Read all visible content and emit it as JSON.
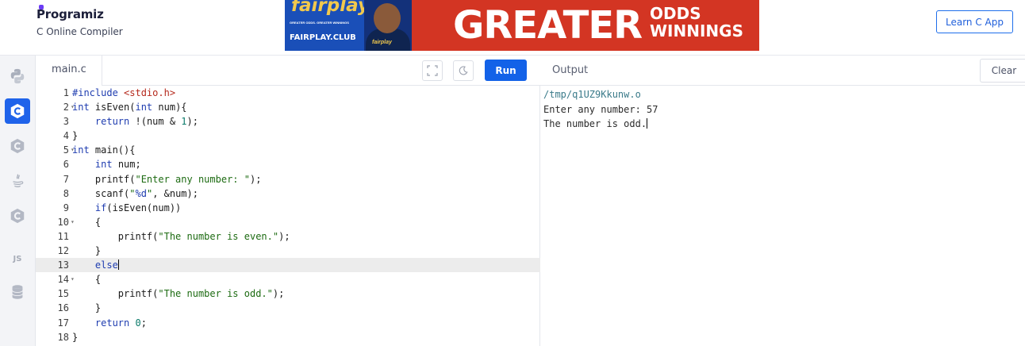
{
  "header": {
    "brand_name": "Programiz",
    "brand_subtitle": "C Online Compiler",
    "learn_button": "Learn C App",
    "ad": {
      "brand": "fairplay",
      "tagline": "GREATER ODDS. GREATER WINNINGS",
      "site": "FAIRPLAY.CLUB",
      "player_logo": "fairplay",
      "headline": "GREATER",
      "headline_right_1": "ODDS",
      "headline_right_2": "WINNINGS"
    }
  },
  "sidebar": {
    "items": [
      {
        "icon": "python-icon",
        "active": false
      },
      {
        "icon": "c-icon",
        "active": true
      },
      {
        "icon": "cpp-icon",
        "active": false
      },
      {
        "icon": "java-icon",
        "active": false
      },
      {
        "icon": "csharp-icon",
        "active": false
      },
      {
        "icon": "js-icon",
        "label": "JS",
        "active": false
      },
      {
        "icon": "database-icon",
        "active": false
      }
    ]
  },
  "editor": {
    "file_tab": "main.c",
    "run_label": "Run",
    "current_line": 13,
    "lines": [
      {
        "n": "1",
        "fold": false
      },
      {
        "n": "2",
        "fold": true
      },
      {
        "n": "3",
        "fold": false
      },
      {
        "n": "4",
        "fold": false
      },
      {
        "n": "5",
        "fold": true
      },
      {
        "n": "6",
        "fold": false
      },
      {
        "n": "7",
        "fold": false
      },
      {
        "n": "8",
        "fold": false
      },
      {
        "n": "9",
        "fold": false
      },
      {
        "n": "10",
        "fold": true
      },
      {
        "n": "11",
        "fold": false
      },
      {
        "n": "12",
        "fold": false
      },
      {
        "n": "13",
        "fold": false
      },
      {
        "n": "14",
        "fold": true
      },
      {
        "n": "15",
        "fold": false
      },
      {
        "n": "16",
        "fold": false
      },
      {
        "n": "17",
        "fold": false
      },
      {
        "n": "18",
        "fold": false
      }
    ],
    "code": {
      "l1_inc": "#include",
      "l1_hdr": "<stdio.h>",
      "l2_kw1": "int",
      "l2_a": " isEven(",
      "l2_kw2": "int",
      "l2_b": " num){",
      "l3_kw": "return",
      "l3_a": " !(num & ",
      "l3_num": "1",
      "l3_b": ");",
      "l4": "}",
      "l5_kw": "int",
      "l5_a": " main(){",
      "l6_kw": "int",
      "l6_a": " num;",
      "l7_a": "printf(",
      "l7_str": "\"Enter any number: \"",
      "l7_b": ");",
      "l8_a": "scanf(",
      "l8_s1": "\"",
      "l8_fmt": "%d",
      "l8_s2": "\"",
      "l8_b": ", &num);",
      "l9_kw": "if",
      "l9_a": "(isEven(num))",
      "l10": "{",
      "l11_a": "printf(",
      "l11_str": "\"The number is even.\"",
      "l11_b": ");",
      "l12": "}",
      "l13_kw": "else",
      "l14": "{",
      "l15_a": "printf(",
      "l15_str": "\"The number is odd.\"",
      "l15_b": ");",
      "l16": "}",
      "l17_kw": "return",
      "l17_num": "0",
      "l17_b": ";",
      "l18": "}"
    }
  },
  "output": {
    "title": "Output",
    "clear_label": "Clear",
    "lines": [
      "/tmp/q1UZ9Kkunw.o",
      "Enter any number: 57",
      "The number is odd."
    ]
  },
  "colors": {
    "accent": "#1362e8",
    "active_sidebar": "#1f63ea",
    "keyword": "#1f3db0",
    "string": "#1d6b12",
    "header_include": "#b52a1d"
  }
}
